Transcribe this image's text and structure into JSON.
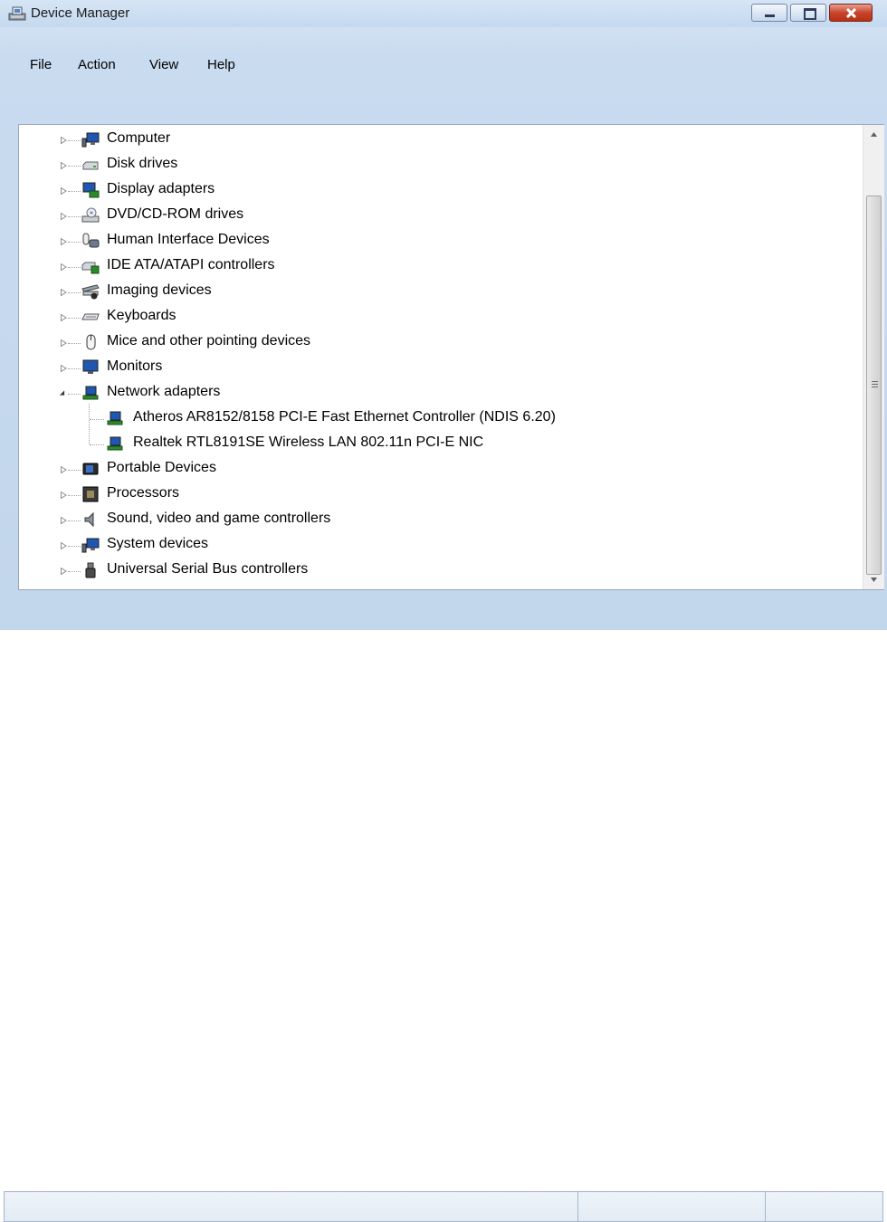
{
  "window": {
    "title": "Device Manager",
    "accent": "#c4d9ef"
  },
  "menu": {
    "items": [
      {
        "label": "File"
      },
      {
        "label": "Action"
      },
      {
        "label": "View"
      },
      {
        "label": "Help"
      }
    ]
  },
  "toolbar": {
    "buttons": [
      {
        "icon": "back-arrow-icon"
      },
      {
        "icon": "forward-arrow-icon"
      },
      {
        "icon": "show-hide-console-tree-icon"
      },
      {
        "icon": "help-icon"
      },
      {
        "icon": "show-hide-action-pane-icon"
      },
      {
        "icon": "scan-hardware-changes-icon"
      }
    ]
  },
  "tree": {
    "categories": [
      {
        "label": "Computer",
        "icon": "computer-icon",
        "expanded": false
      },
      {
        "label": "Disk drives",
        "icon": "disk-drive-icon",
        "expanded": false
      },
      {
        "label": "Display adapters",
        "icon": "display-adapter-icon",
        "expanded": false
      },
      {
        "label": "DVD/CD-ROM drives",
        "icon": "dvd-drive-icon",
        "expanded": false
      },
      {
        "label": "Human Interface Devices",
        "icon": "hid-icon",
        "expanded": false
      },
      {
        "label": "IDE ATA/ATAPI controllers",
        "icon": "ide-controller-icon",
        "expanded": false
      },
      {
        "label": "Imaging devices",
        "icon": "imaging-device-icon",
        "expanded": false
      },
      {
        "label": "Keyboards",
        "icon": "keyboard-icon",
        "expanded": false
      },
      {
        "label": "Mice and other pointing devices",
        "icon": "mouse-icon",
        "expanded": false
      },
      {
        "label": "Monitors",
        "icon": "monitor-icon",
        "expanded": false
      },
      {
        "label": "Network adapters",
        "icon": "network-adapter-icon",
        "expanded": true,
        "children": [
          {
            "label": "Atheros AR8152/8158 PCI-E Fast Ethernet Controller (NDIS 6.20)",
            "icon": "network-adapter-icon"
          },
          {
            "label": "Realtek RTL8191SE Wireless LAN 802.11n PCI-E NIC",
            "icon": "network-adapter-icon"
          }
        ]
      },
      {
        "label": "Portable Devices",
        "icon": "portable-device-icon",
        "expanded": false
      },
      {
        "label": "Processors",
        "icon": "processor-icon",
        "expanded": false
      },
      {
        "label": "Sound, video and game controllers",
        "icon": "speaker-icon",
        "expanded": false
      },
      {
        "label": "System devices",
        "icon": "system-device-icon",
        "expanded": false
      },
      {
        "label": "Universal Serial Bus controllers",
        "icon": "usb-icon",
        "expanded": false
      }
    ]
  },
  "statusbar": {
    "segments": [
      "",
      "",
      ""
    ]
  }
}
